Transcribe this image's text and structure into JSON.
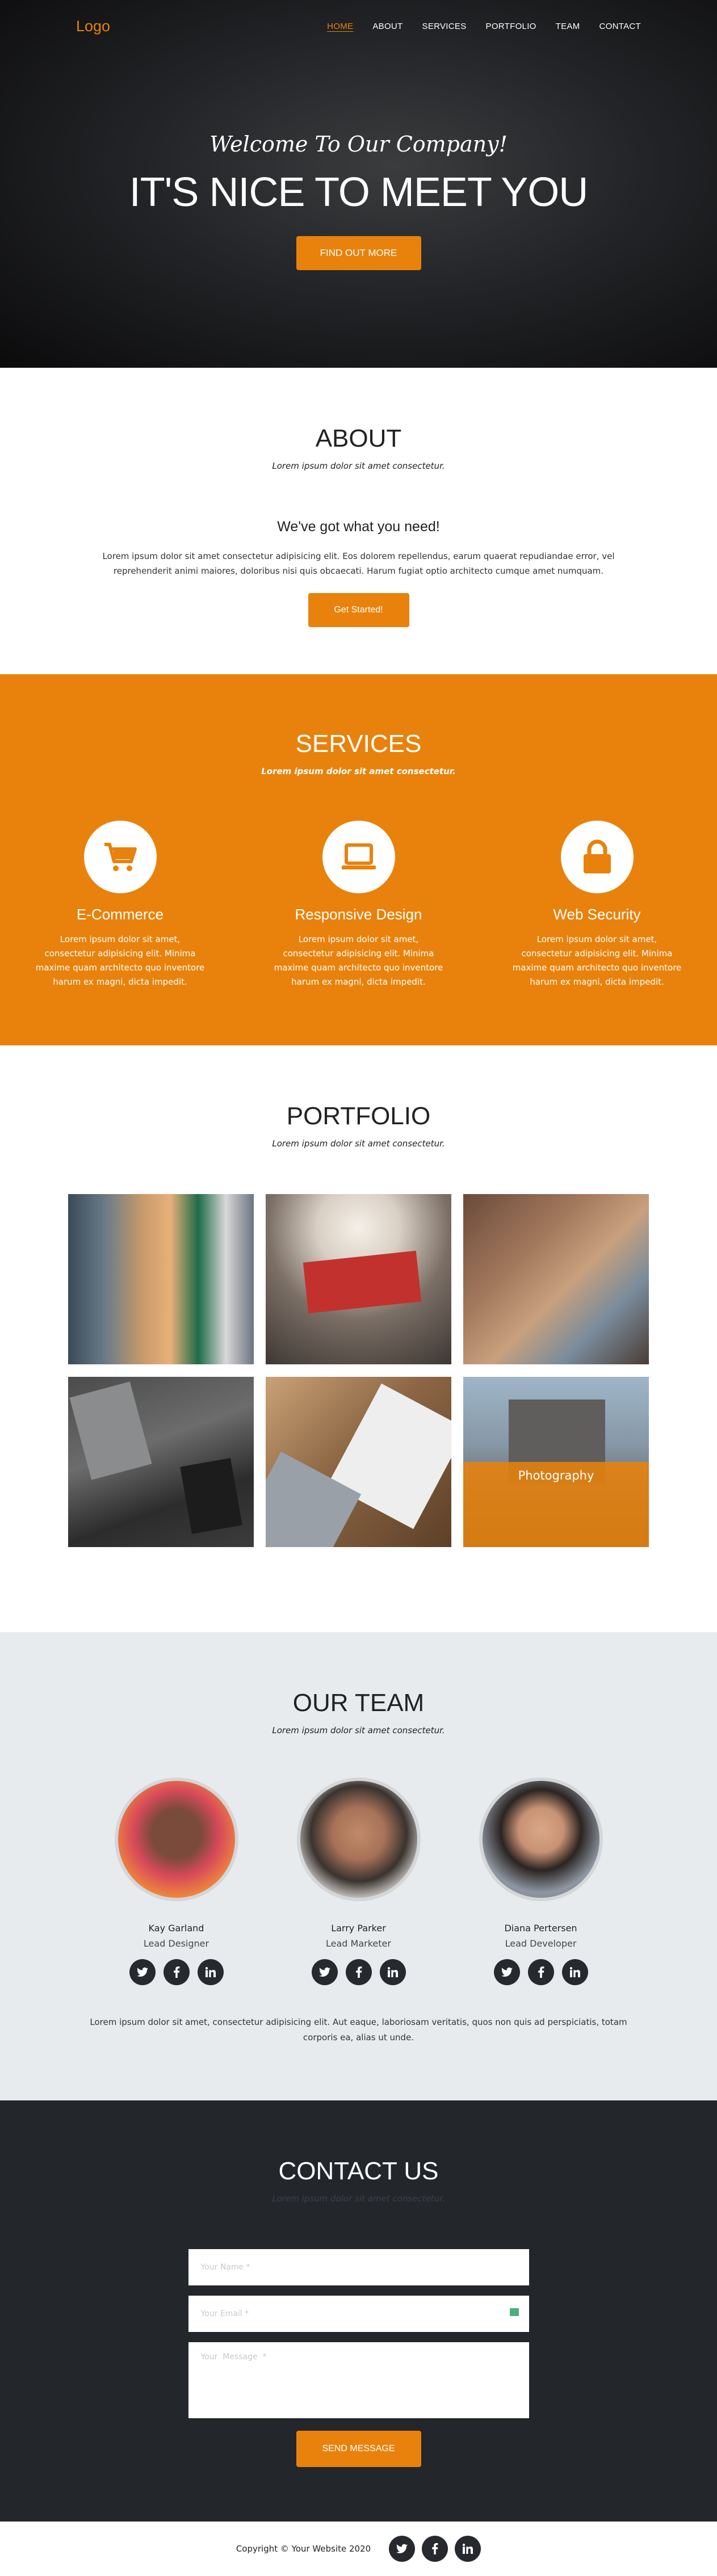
{
  "header": {
    "logo": "Logo",
    "menu": [
      "HOME",
      "ABOUT",
      "SERVICES",
      "PORTFOLIO",
      "TEAM",
      "CONTACT"
    ],
    "active_index": 0
  },
  "hero": {
    "subtitle": "Welcome To Our Company!",
    "title": "IT'S NICE TO MEET YOU",
    "button": "FIND OUT MORE"
  },
  "about": {
    "title": "ABOUT",
    "subtitle": "Lorem ipsum dolor sit amet consectetur.",
    "heading": "We've got what you need!",
    "text": "Lorem ipsum dolor sit amet consectetur adipisicing elit. Eos dolorem repellendus, earum quaerat repudiandae error, vel reprehenderit animi maiores, doloribus nisi quis obcaecati. Harum fugiat optio architecto cumque amet numquam.",
    "button": "Get Started!"
  },
  "services": {
    "title": "SERVICES",
    "subtitle": "Lorem ipsum dolor sit amet consectetur.",
    "items": [
      {
        "title": "E-Commerce",
        "icon": "cart-icon",
        "text": "Lorem ipsum dolor sit amet, consectetur adipisicing elit. Minima maxime quam architecto quo inventore harum ex magni, dicta impedit."
      },
      {
        "title": "Responsive Design",
        "icon": "laptop-icon",
        "text": "Lorem ipsum dolor sit amet, consectetur adipisicing elit. Minima maxime quam architecto quo inventore harum ex magni, dicta impedit."
      },
      {
        "title": "Web Security",
        "icon": "lock-icon",
        "text": "Lorem ipsum dolor sit amet, consectetur adipisicing elit. Minima maxime quam architecto quo inventore harum ex magni, dicta impedit."
      }
    ]
  },
  "portfolio": {
    "title": "PORTFOLIO",
    "subtitle": "Lorem ipsum dolor sit amet consectetur.",
    "hover_label": "Photography"
  },
  "team": {
    "title": "OUR TEAM",
    "subtitle": "Lorem ipsum dolor sit amet consectetur.",
    "members": [
      {
        "name": "Kay Garland",
        "role": "Lead Designer"
      },
      {
        "name": "Larry Parker",
        "role": "Lead Marketer"
      },
      {
        "name": "Diana Pertersen",
        "role": "Lead Developer"
      }
    ],
    "text": "Lorem ipsum dolor sit amet, consectetur adipisicing elit. Aut eaque, laboriosam veritatis, quos non quis ad perspiciatis, totam corporis ea, alias ut unde."
  },
  "contact": {
    "title": "CONTACT US",
    "subtitle": "Lorem ipsum dolor sit amet consectetur.",
    "name_placeholder": "Your Name *",
    "email_placeholder": "Your Email *",
    "message_placeholder": "Your  Message  *",
    "button": "SEND MESSAGE"
  },
  "footer": {
    "copyright": "Copyright © Your Website 2020"
  },
  "colors": {
    "accent": "#e8820c",
    "dark": "#23262b",
    "light": "#e8ebee"
  }
}
